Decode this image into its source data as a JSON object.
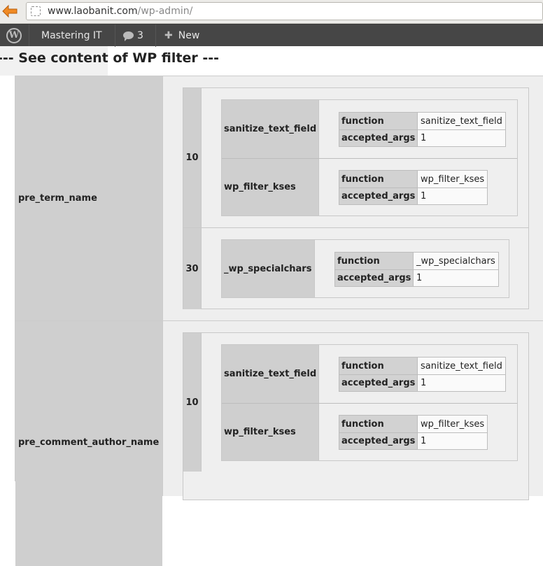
{
  "browser": {
    "url_host": "www.laobanit.com",
    "url_path": "/wp-admin/"
  },
  "adminbar": {
    "site_name": "Mastering IT",
    "comments_count": "3",
    "new_label": "New"
  },
  "page_title": "--- See content of WP filter ---",
  "hooks": [
    {
      "name": "pre_term_name",
      "priorities": [
        {
          "priority": "10",
          "callbacks": [
            {
              "name": "sanitize_text_field",
              "function_label": "function",
              "function": "sanitize_text_field",
              "args_label": "accepted_args",
              "accepted_args": "1"
            },
            {
              "name": "wp_filter_kses",
              "function_label": "function",
              "function": "wp_filter_kses",
              "args_label": "accepted_args",
              "accepted_args": "1"
            }
          ]
        },
        {
          "priority": "30",
          "callbacks": [
            {
              "name": "_wp_specialchars",
              "function_label": "function",
              "function": "_wp_specialchars",
              "args_label": "accepted_args",
              "accepted_args": "1"
            }
          ]
        }
      ]
    },
    {
      "name": "pre_comment_author_name",
      "priorities": [
        {
          "priority": "10",
          "callbacks": [
            {
              "name": "sanitize_text_field",
              "function_label": "function",
              "function": "sanitize_text_field",
              "args_label": "accepted_args",
              "accepted_args": "1"
            },
            {
              "name": "wp_filter_kses",
              "function_label": "function",
              "function": "wp_filter_kses",
              "args_label": "accepted_args",
              "accepted_args": "1"
            }
          ]
        }
      ]
    }
  ]
}
